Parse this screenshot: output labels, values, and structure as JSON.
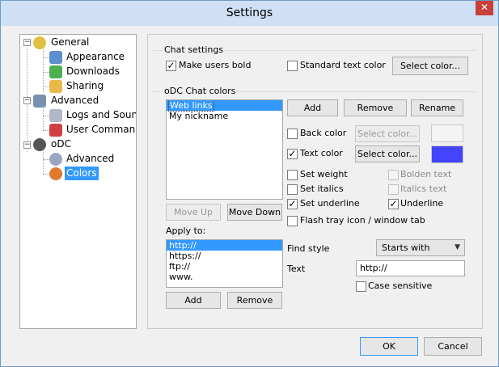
{
  "window": {
    "title": "Settings",
    "close_glyph": "✕"
  },
  "colors": {
    "text_color_swatch": "#4444ff",
    "back_color_swatch": "#f4f4f4",
    "selection": "#3399ff"
  },
  "tree": {
    "general": "General",
    "appearance": "Appearance",
    "downloads": "Downloads",
    "sharing": "Sharing",
    "advanced": "Advanced",
    "logs_sound": "Logs and Sound",
    "user_command": "User Command",
    "odc": "oDC",
    "odc_advanced": "Advanced",
    "colors": "Colors"
  },
  "chat_settings": {
    "title": "Chat settings",
    "make_users_bold": "Make users bold",
    "standard_text_color": "Standard text color",
    "select_color": "Select color..."
  },
  "odc_colors": {
    "title": "oDC Chat colors",
    "items": [
      "Web links",
      "My nickname"
    ],
    "add": "Add",
    "remove": "Remove",
    "rename": "Rename",
    "back_color": "Back color",
    "text_color": "Text color",
    "select_color": "Select color...",
    "set_weight": "Set weight",
    "bolden_text": "Bolden text",
    "set_italics": "Set italics",
    "italics_text": "Italics text",
    "set_underline": "Set underline",
    "underline": "Underline",
    "flash_tray": "Flash tray icon / window tab",
    "move_up": "Move Up",
    "move_down": "Move Down",
    "apply_to": "Apply to:",
    "apply_items": [
      "http://",
      "https://",
      "ftp://",
      "www."
    ],
    "apply_add": "Add",
    "apply_remove": "Remove",
    "find_style_label": "Find style",
    "find_style_value": "Starts with",
    "text_label": "Text",
    "text_value": "http://",
    "case_sensitive": "Case sensitive"
  },
  "footer": {
    "ok": "OK",
    "cancel": "Cancel"
  }
}
